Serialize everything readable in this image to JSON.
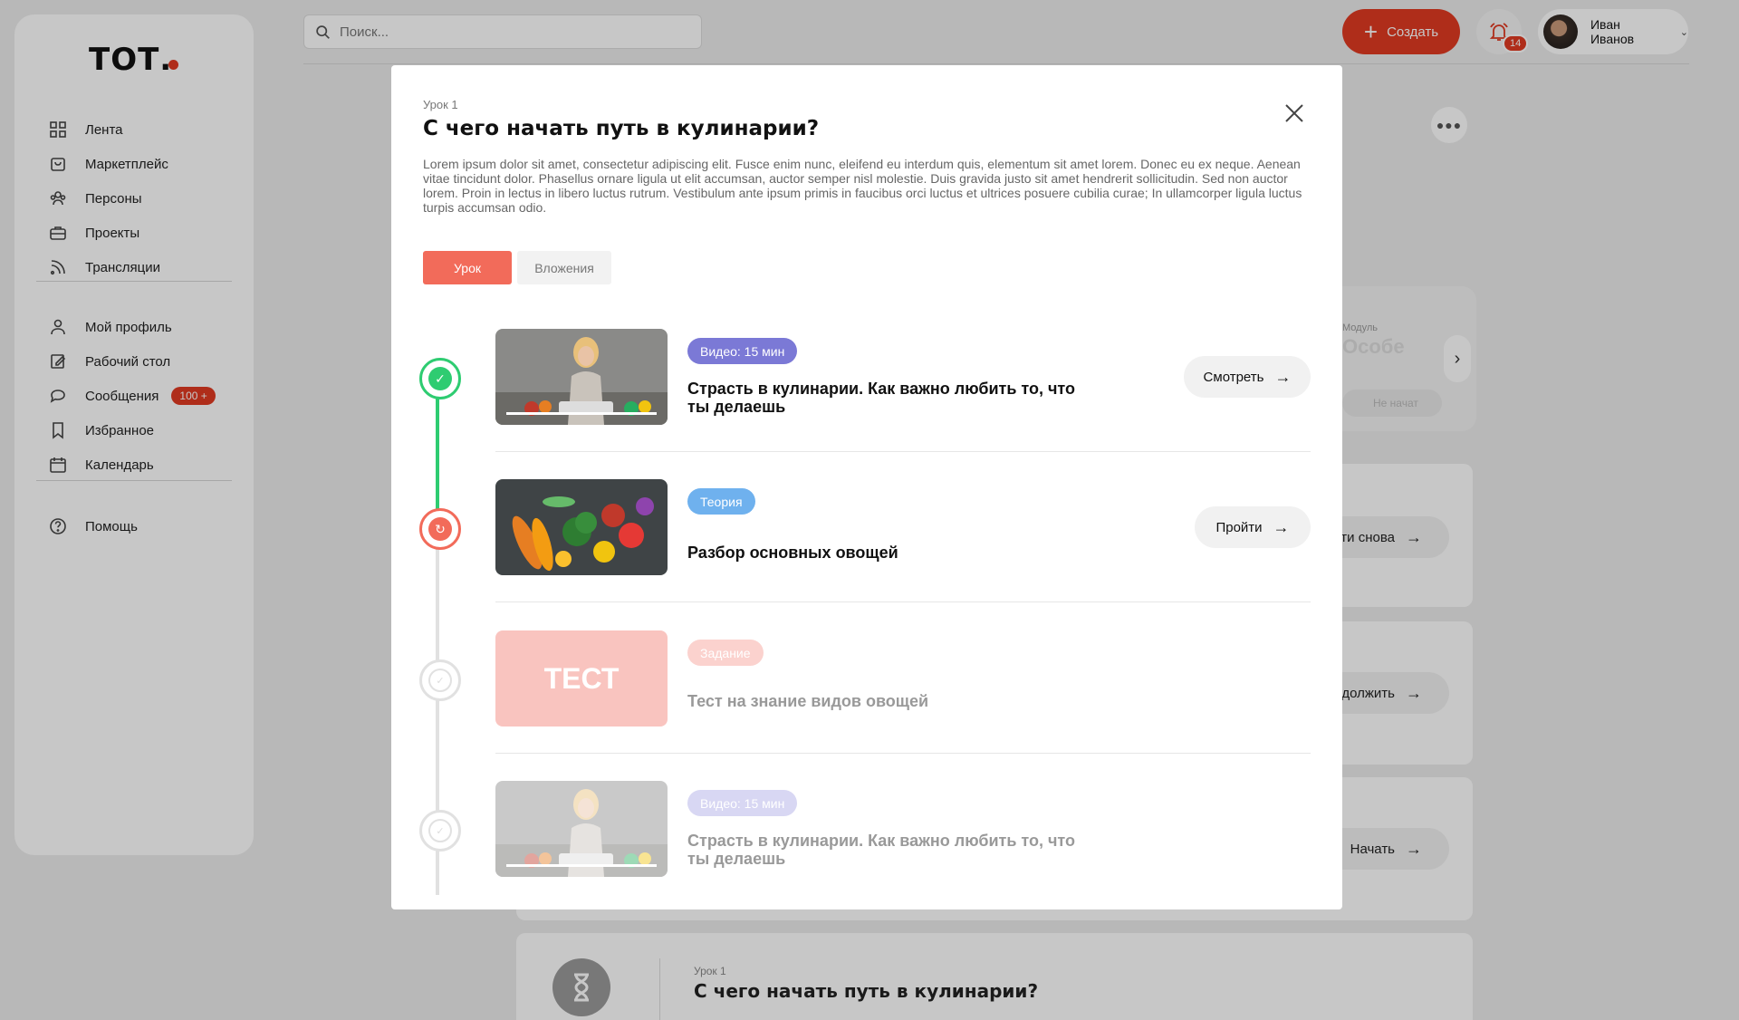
{
  "logo": "ТОТ.",
  "sidebar": {
    "items": [
      {
        "label": "Лента"
      },
      {
        "label": "Маркетплейс"
      },
      {
        "label": "Персоны"
      },
      {
        "label": "Проекты"
      },
      {
        "label": "Трансляции"
      },
      {
        "label": "Мой профиль"
      },
      {
        "label": "Рабочий стол"
      },
      {
        "label": "Сообщения",
        "badge": "100 +"
      },
      {
        "label": "Избранное"
      },
      {
        "label": "Календарь"
      },
      {
        "label": "Помощь"
      }
    ]
  },
  "header": {
    "search_placeholder": "Поиск...",
    "create_label": "Создать",
    "notifications_count": "14",
    "user_name": "Иван Иванов"
  },
  "background": {
    "slide_module_label": "Модуль",
    "slide_title": "Особе",
    "slide_button": "Не начат",
    "card_buttons": [
      "йти снова",
      "одолжить",
      "Начать"
    ],
    "bottom_lesson": "Урок 1",
    "bottom_title": "С чего начать путь в кулинарии?"
  },
  "modal": {
    "lesson_label": "Урок 1",
    "title": "С чего начать путь в кулинарии?",
    "description": "Lorem ipsum dolor sit amet, consectetur adipiscing elit. Fusce enim nunc, eleifend eu interdum quis, elementum sit amet lorem. Donec eu ex neque. Aenean vitae tincidunt dolor. Phasellus ornare ligula ut elit accumsan, auctor semper nisl molestie. Duis gravida justo sit amet hendrerit sollicitudin. Sed non auctor lorem. Proin in lectus in libero luctus rutrum. Vestibulum ante ipsum primis in faucibus orci luctus et ultrices posuere cubilia curae; In ullamcorper ligula luctus turpis accumsan odio.",
    "tabs": [
      {
        "label": "Урок",
        "active": true
      },
      {
        "label": "Вложения",
        "active": false
      }
    ],
    "items": [
      {
        "badge": "Видео: 15 мин",
        "title": "Страсть в кулинарии. Как важно любить то, что ты делаешь",
        "action": "Смотреть",
        "status": "completed"
      },
      {
        "badge": "Теория",
        "title": "Разбор основных овощей",
        "action": "Пройти",
        "status": "in-progress"
      },
      {
        "badge": "Задание",
        "title": "Тест на знание видов овощей",
        "thumb_text": "ТЕСТ",
        "status": "locked"
      },
      {
        "badge": "Видео: 15 мин",
        "title": "Страсть в кулинарии. Как важно любить то, что ты делаешь",
        "status": "locked"
      }
    ]
  },
  "colors": {
    "accent": "#e03a22",
    "tab_active": "#f26b5a",
    "completed": "#2ecc71",
    "video_badge": "#7b79d6",
    "theory_badge": "#6fb1ee",
    "task_badge": "#f9c4bf"
  }
}
